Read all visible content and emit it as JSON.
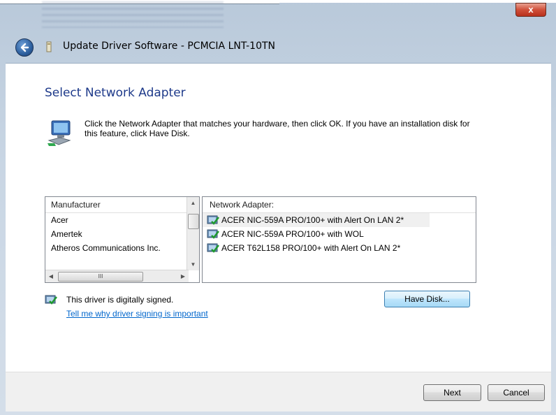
{
  "window": {
    "title": "Update Driver Software - PCMCIA LNT-10TN",
    "close_glyph": "x"
  },
  "page": {
    "heading": "Select Network Adapter",
    "instructions": "Click the Network Adapter that matches your hardware, then click OK. If you have an installation disk for this feature, click Have Disk."
  },
  "manufacturer_list": {
    "header": "Manufacturer",
    "items": [
      "Acer",
      "Amertek",
      "Atheros Communications Inc."
    ],
    "hscroll_thumb_glyph": "III"
  },
  "adapter_list": {
    "header": "Network Adapter:",
    "items": [
      "ACER NIC-559A PRO/100+ with Alert On LAN 2*",
      "ACER NIC-559A PRO/100+ with WOL",
      "ACER T62L158 PRO/100+ with Alert On LAN 2*"
    ],
    "selected_index": 0
  },
  "signing": {
    "status": "This driver is digitally signed.",
    "link": "Tell me why driver signing is important"
  },
  "buttons": {
    "have_disk": "Have Disk...",
    "next": "Next",
    "cancel": "Cancel"
  },
  "colors": {
    "heading": "#1e3a8a",
    "link": "#0066cc",
    "close": "#c7472f"
  },
  "icons": {
    "back": "back-arrow-icon",
    "network": "network-adapter-icon",
    "driver": "signed-driver-icon"
  }
}
